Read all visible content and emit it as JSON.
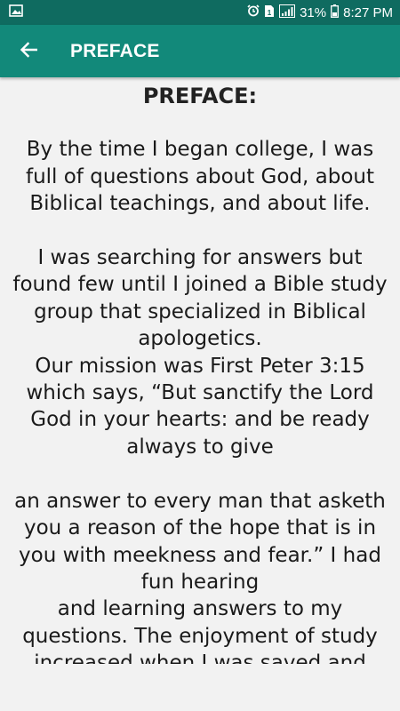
{
  "status_bar": {
    "battery_percent": "31%",
    "time": "8:27 PM",
    "icons": [
      "image-notification-icon",
      "alarm-icon",
      "sim-icon",
      "signal-icon",
      "battery-icon"
    ]
  },
  "app_bar": {
    "title": "PREFACE",
    "back_icon": "arrow-left-icon",
    "color": "#12897a"
  },
  "content": {
    "heading": "PREFACE:",
    "paragraphs": [
      "\n By the time I began college, I was full of questions about God, about Biblical teachings, and about life.\n\n I was searching for answers but found few until I joined a Bible study group that specialized in Biblical apologetics.\n Our mission was First Peter 3:15 which says, “But sanctify the Lord God in your hearts: and be ready always to give\n\n an answer to every man that asketh you a reason of the hope that is in you with meekness and fear.” I had fun hearing\n and learning answers to my questions. The enjoyment of study increased when I was saved and"
    ]
  }
}
